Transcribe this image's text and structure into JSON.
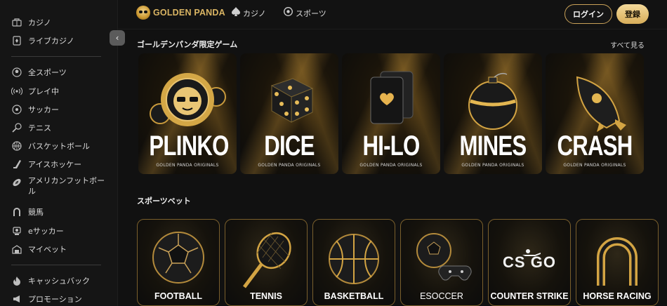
{
  "sidebar": {
    "items": [
      {
        "label": "カジノ",
        "icon": "casino-icon"
      },
      {
        "label": "ライブカジノ",
        "icon": "live-casino-icon"
      },
      {
        "label": "全スポーツ",
        "icon": "all-sports-icon"
      },
      {
        "label": "プレイ中",
        "icon": "live-signal-icon"
      },
      {
        "label": "サッカー",
        "icon": "soccer-icon"
      },
      {
        "label": "テニス",
        "icon": "tennis-icon"
      },
      {
        "label": "バスケットボール",
        "icon": "basketball-icon"
      },
      {
        "label": "アイスホッケー",
        "icon": "hockey-icon"
      },
      {
        "label": "アメリカンフットボール",
        "icon": "american-football-icon"
      },
      {
        "label": "競馬",
        "icon": "horseshoe-icon"
      },
      {
        "label": "eサッカー",
        "icon": "esoccer-icon"
      },
      {
        "label": "マイベット",
        "icon": "my-bets-icon"
      },
      {
        "label": "キャッシュバック",
        "icon": "cashback-icon"
      },
      {
        "label": "プロモーション",
        "icon": "promotion-icon"
      }
    ],
    "collapse_glyph": "‹"
  },
  "header": {
    "logo_text": "GOLDEN PANDA",
    "nav": [
      {
        "label": "カジノ",
        "icon": "spade-icon"
      },
      {
        "label": "スポーツ",
        "icon": "sports-ball-icon"
      }
    ],
    "login_label": "ログイン",
    "signup_label": "登録"
  },
  "games_section": {
    "title": "ゴールデンパンダ限定ゲーム",
    "see_all": "すべて見る",
    "cards": [
      {
        "name": "PLINKO",
        "subtitle": "GOLDEN PANDA ORIGINALS"
      },
      {
        "name": "DICE",
        "subtitle": "GOLDEN PANDA ORIGINALS"
      },
      {
        "name": "HI-LO",
        "subtitle": "GOLDEN PANDA ORIGINALS"
      },
      {
        "name": "MINES",
        "subtitle": "GOLDEN PANDA ORIGINALS"
      },
      {
        "name": "CRASH",
        "subtitle": "GOLDEN PANDA ORIGINALS"
      }
    ]
  },
  "sports_section": {
    "title": "スポーツベット",
    "cards": [
      {
        "label": "FOOTBALL"
      },
      {
        "label": "TENNIS"
      },
      {
        "label": "BASKETBALL"
      },
      {
        "label": "ESOCCER"
      },
      {
        "label": "COUNTER STRIKE"
      },
      {
        "label": "HORSE RACING"
      }
    ],
    "csgo_logo": "CS GO"
  },
  "colors": {
    "gold": "#d9b463",
    "gold_border": "#c9a158",
    "background": "#111111",
    "sidebar": "#151515"
  }
}
